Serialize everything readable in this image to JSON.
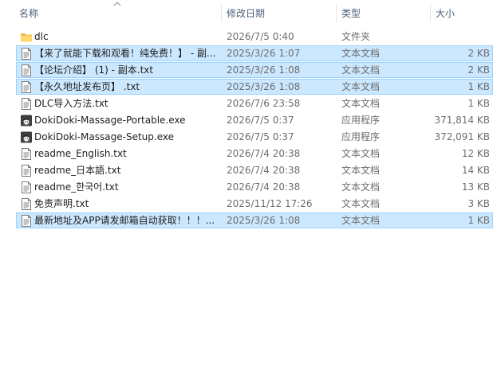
{
  "columns": {
    "name": "名称",
    "date": "修改日期",
    "type": "类型",
    "size": "大小"
  },
  "files": [
    {
      "name": "dlc",
      "date": "2026/7/5 0:40",
      "type": "文件夹",
      "size": "",
      "icon": "folder-icon",
      "selected": false
    },
    {
      "name": "【来了就能下载和观看！纯免费！】 - 副...",
      "date": "2025/3/26 1:07",
      "type": "文本文档",
      "size": "2 KB",
      "icon": "text-file-icon",
      "selected": true
    },
    {
      "name": "【论坛介绍】 (1) - 副本.txt",
      "date": "2025/3/26 1:08",
      "type": "文本文档",
      "size": "2 KB",
      "icon": "text-file-icon",
      "selected": true
    },
    {
      "name": "【永久地址发布页】 .txt",
      "date": "2025/3/26 1:08",
      "type": "文本文档",
      "size": "1 KB",
      "icon": "text-file-icon",
      "selected": true
    },
    {
      "name": "DLC导入方法.txt",
      "date": "2026/7/6 23:58",
      "type": "文本文档",
      "size": "1 KB",
      "icon": "text-file-icon",
      "selected": false
    },
    {
      "name": "DokiDoki-Massage-Portable.exe",
      "date": "2026/7/5 0:37",
      "type": "应用程序",
      "size": "371,814 KB",
      "icon": "app-icon",
      "selected": false
    },
    {
      "name": "DokiDoki-Massage-Setup.exe",
      "date": "2026/7/5 0:37",
      "type": "应用程序",
      "size": "372,091 KB",
      "icon": "app-icon",
      "selected": false
    },
    {
      "name": "readme_English.txt",
      "date": "2026/7/4 20:38",
      "type": "文本文档",
      "size": "12 KB",
      "icon": "text-file-icon",
      "selected": false
    },
    {
      "name": "readme_日本語.txt",
      "date": "2026/7/4 20:38",
      "type": "文本文档",
      "size": "14 KB",
      "icon": "text-file-icon",
      "selected": false
    },
    {
      "name": "readme_한국어.txt",
      "date": "2026/7/4 20:38",
      "type": "文本文档",
      "size": "13 KB",
      "icon": "text-file-icon",
      "selected": false
    },
    {
      "name": "免责声明.txt",
      "date": "2025/11/12 17:26",
      "type": "文本文档",
      "size": "3 KB",
      "icon": "text-file-icon",
      "selected": false
    },
    {
      "name": "最新地址及APP请发邮箱自动获取！！！...",
      "date": "2025/3/26 1:08",
      "type": "文本文档",
      "size": "1 KB",
      "icon": "text-file-icon",
      "selected": true
    }
  ]
}
